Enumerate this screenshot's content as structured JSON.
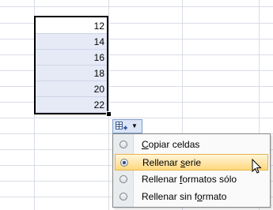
{
  "selection": {
    "cells": [
      "12",
      "14",
      "16",
      "18",
      "20",
      "22"
    ]
  },
  "autofill": {
    "icon": "autofill-options-icon",
    "caret": "▼"
  },
  "menu": {
    "items": [
      {
        "pre": "",
        "key": "C",
        "post": "opiar celdas",
        "selected": false
      },
      {
        "pre": "Rellenar ",
        "key": "s",
        "post": "erie",
        "selected": true
      },
      {
        "pre": "Rellenar ",
        "key": "f",
        "post": "ormatos sólo",
        "selected": false
      },
      {
        "pre": "Rellenar sin f",
        "key": "o",
        "post": "rmato",
        "selected": false
      }
    ],
    "hovered_index": 1,
    "accent_color": "#ffd87e"
  },
  "cursor": {
    "icon": "mouse-pointer-icon"
  }
}
